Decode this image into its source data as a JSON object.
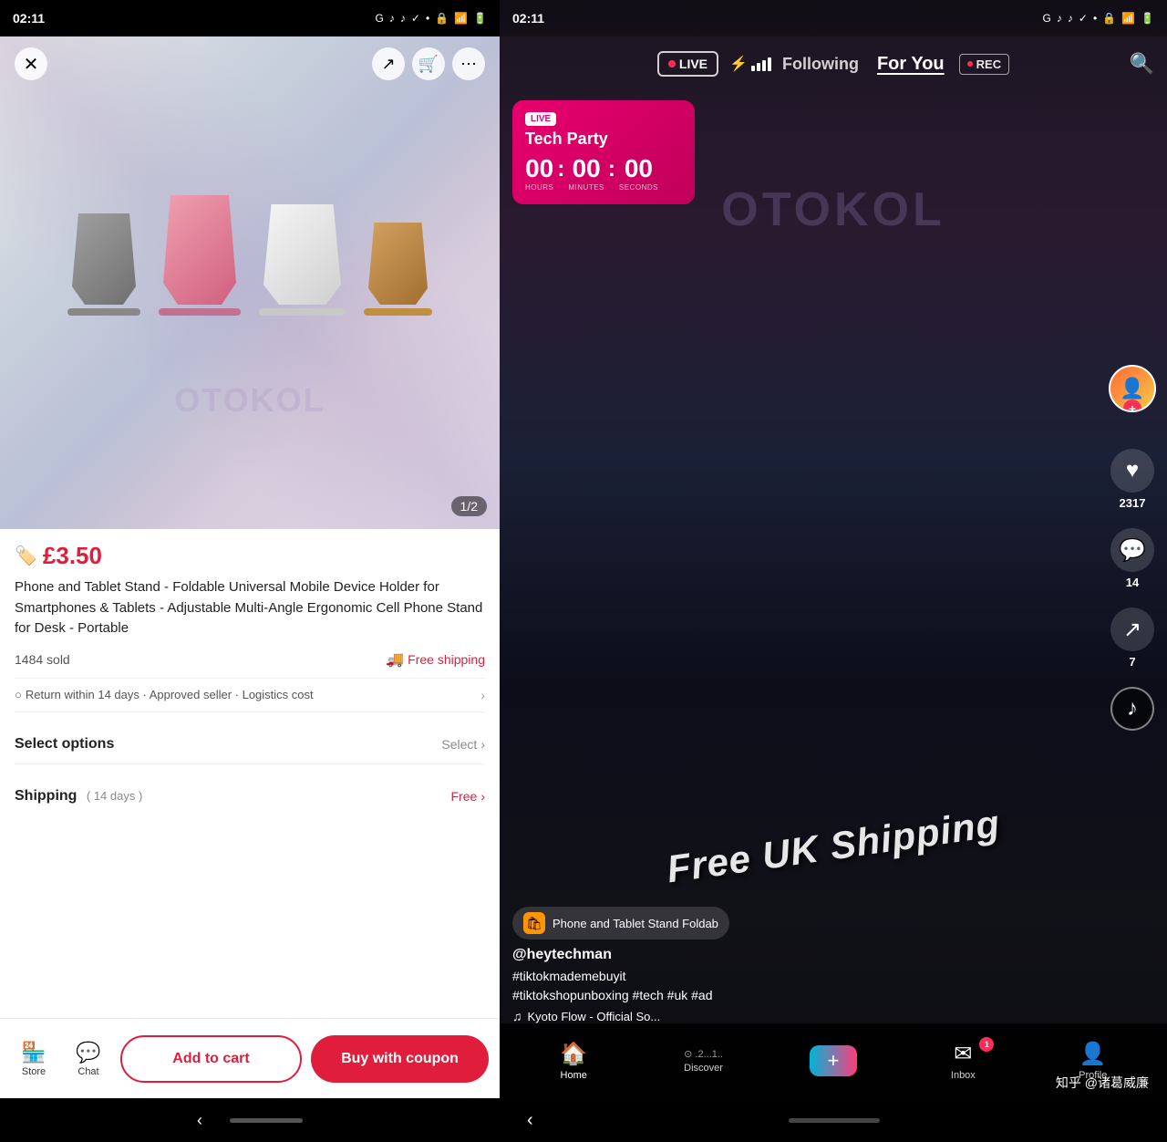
{
  "left": {
    "status_time": "02:11",
    "status_icons": [
      "G",
      "TikTok",
      "TikTok",
      "✓",
      "•"
    ],
    "image_counter": "1/2",
    "price": "£3.50",
    "product_title": "Phone and Tablet Stand - Foldable Universal Mobile Device Holder for Smartphones & Tablets - Adjustable Multi-Angle Ergonomic Cell Phone Stand for Desk - Portable",
    "sold_count": "1484 sold",
    "free_shipping": "Free shipping",
    "return_policy": "Return within 14 days · Approved seller · Logistics cost",
    "select_options_label": "Select options",
    "select_placeholder": "Select",
    "shipping_label": "Shipping",
    "shipping_days": "( 14 days )",
    "shipping_free": "Free",
    "add_to_cart_label": "Add to cart",
    "buy_with_coupon_label": "Buy with coupon",
    "store_label": "Store",
    "chat_label": "Chat"
  },
  "right": {
    "status_time": "02:11",
    "live_label": "LIVE",
    "following_label": "Following",
    "for_you_label": "For You",
    "rec_label": "REC",
    "tech_party_title": "Tech Party",
    "hours_label": "HOURS",
    "minutes_label": "MINUTES",
    "seconds_label": "SECONDS",
    "timer_hours": "00",
    "timer_minutes": "00",
    "timer_seconds": "00",
    "free_shipping_overlay": "Free UK Shipping",
    "product_chip_text": "Phone and Tablet Stand  Foldab",
    "username": "@heytechman",
    "hashtags": "#tiktokmademebuyit\n#tiktokshopunboxing #tech #uk #ad",
    "music": "Kyoto Flow - Official So...",
    "likes_count": "2317",
    "comments_count": "14",
    "shares_count": "7",
    "home_label": "Home",
    "discover_label": "Discover",
    "inbox_label": "Inbox",
    "inbox_badge": "1",
    "profile_label": "Profile",
    "zhihu_watermark": "知乎 @诸葛威廉",
    "watermark": "OTOKOL"
  }
}
